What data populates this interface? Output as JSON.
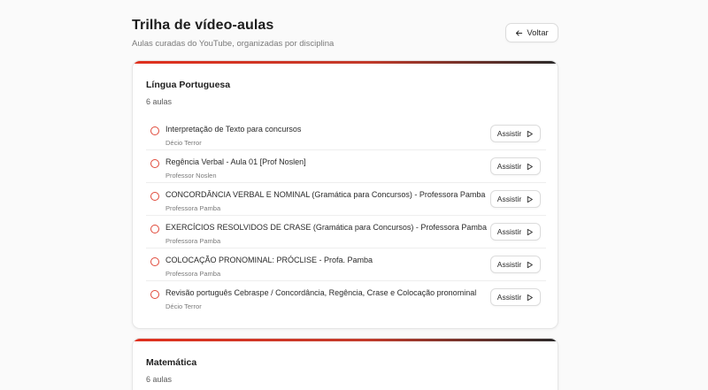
{
  "header": {
    "title": "Trilha de vídeo-aulas",
    "subtitle": "Aulas curadas do YouTube, organizadas por disciplina",
    "back_label": "Voltar"
  },
  "subjects": [
    {
      "name": "Língua Portuguesa",
      "count": "6 aulas",
      "lessons": [
        {
          "title": "Interpretação de Texto para concursos",
          "author": "Décio Terror",
          "action": "Assistir"
        },
        {
          "title": "Regência Verbal - Aula 01 [Prof Noslen]",
          "author": "Professor Noslen",
          "action": "Assistir"
        },
        {
          "title": "CONCORDÂNCIA VERBAL E NOMINAL (Gramática para Concursos) - Professora Pamba",
          "author": "Professora Pamba",
          "action": "Assistir"
        },
        {
          "title": "EXERCÍCIOS RESOLVIDOS DE CRASE (Gramática para Concursos) - Professora Pamba",
          "author": "Professora Pamba",
          "action": "Assistir"
        },
        {
          "title": "COLOCAÇÃO PRONOMINAL: PRÓCLISE - Profa. Pamba",
          "author": "Professora Pamba",
          "action": "Assistir"
        },
        {
          "title": "Revisão português Cebraspe / Concordância, Regência, Crase e Colocação pronominal",
          "author": "Décio Terror",
          "action": "Assistir"
        }
      ]
    },
    {
      "name": "Matemática",
      "count": "6 aulas",
      "lessons": []
    }
  ],
  "icons": {
    "back": "arrow-left-icon",
    "watch": "play-icon",
    "status": "circle-icon"
  },
  "colors": {
    "accent": "#e0301e",
    "accent_dark": "#2a2a2a"
  }
}
